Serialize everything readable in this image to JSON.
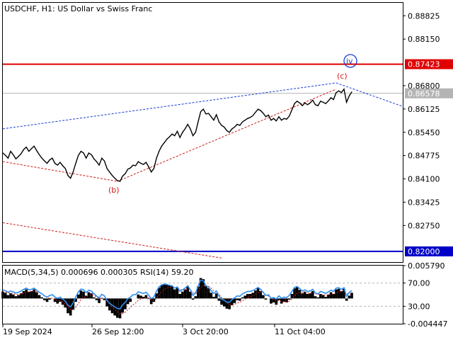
{
  "title": "USDCHF, H1:  US Dollar vs Swiss Franc",
  "colors": {
    "price": "#000000",
    "resistance": "#e00000",
    "support": "#0000c8",
    "current_line": "#b4b4b4",
    "channel_upper": "#1a3cd8",
    "channel_lower": "#d01818",
    "wave_red": "#d01818",
    "wave_blue": "#1a3cd8",
    "macd_hist": "#000000",
    "rsi": "#2d8ef0",
    "macd_signal": "#d01818"
  },
  "chart_data": [
    {
      "type": "line",
      "title": "USDCHF, H1:  US Dollar vs Swiss Franc",
      "x_ticks": [
        "19 Sep 2024",
        "26 Sep 12:00",
        "3 Oct 20:00",
        "11 Oct 04:00"
      ],
      "y_ticks": [
        "0.88825",
        "0.88150",
        "0.86800",
        "0.86125",
        "0.85450",
        "0.84775",
        "0.84100",
        "0.83425",
        "0.82750"
      ],
      "ylim": [
        0.8169,
        0.892
      ],
      "levels": [
        {
          "label": "0.87423",
          "value": 0.87423,
          "role": "resistance"
        },
        {
          "label": "0.86578",
          "value": 0.86578,
          "role": "current"
        },
        {
          "label": "0.82000",
          "value": 0.82,
          "role": "support"
        }
      ],
      "series": [
        {
          "values": [
            0.8485,
            0.8478,
            0.847,
            0.849,
            0.848,
            0.8468,
            0.8475,
            0.8483,
            0.8495,
            0.8502,
            0.849,
            0.8498,
            0.8505,
            0.8492,
            0.848,
            0.847,
            0.8462,
            0.8455,
            0.8465,
            0.847,
            0.8455,
            0.845,
            0.8458,
            0.8448,
            0.844,
            0.842,
            0.8412,
            0.843,
            0.8455,
            0.8478,
            0.849,
            0.8485,
            0.847,
            0.8485,
            0.848,
            0.8468,
            0.846,
            0.845,
            0.847,
            0.8462,
            0.844,
            0.843,
            0.842,
            0.8412,
            0.8405,
            0.8403,
            0.8418,
            0.8425,
            0.8438,
            0.8442,
            0.845,
            0.8448,
            0.846,
            0.8455,
            0.8452,
            0.8458,
            0.8445,
            0.843,
            0.844,
            0.847,
            0.849,
            0.8505,
            0.8515,
            0.8525,
            0.8532,
            0.854,
            0.8535,
            0.8548,
            0.853,
            0.8545,
            0.8555,
            0.8568,
            0.8555,
            0.8535,
            0.8545,
            0.8575,
            0.8605,
            0.8612,
            0.8598,
            0.86,
            0.859,
            0.858,
            0.8596,
            0.8575,
            0.8565,
            0.856,
            0.855,
            0.8545,
            0.8555,
            0.856,
            0.8568,
            0.8565,
            0.8575,
            0.858,
            0.8585,
            0.8588,
            0.8593,
            0.8603,
            0.8612,
            0.8608,
            0.86,
            0.859,
            0.8595,
            0.858,
            0.8585,
            0.8578,
            0.859,
            0.858,
            0.8585,
            0.8583,
            0.8592,
            0.861,
            0.8628,
            0.8635,
            0.863,
            0.8622,
            0.863,
            0.8625,
            0.863,
            0.8638,
            0.8625,
            0.8622,
            0.8635,
            0.8632,
            0.8628,
            0.8636,
            0.8645,
            0.864,
            0.866,
            0.8665,
            0.866,
            0.867,
            0.8632,
            0.865,
            0.8662
          ],
          "label_points": [
            {
              "x": 0,
              "y": 0.8485,
              "label": ""
            },
            {
              "x": 44,
              "y": 0.8403,
              "label": "(b)"
            },
            {
              "x": 128,
              "y": 0.867,
              "label": "(c)"
            }
          ]
        }
      ],
      "annotations": [
        {
          "text": "(b)",
          "color": "wave_red"
        },
        {
          "text": "(c)",
          "color": "wave_red"
        },
        {
          "text": "iv",
          "color": "wave_blue"
        }
      ]
    },
    {
      "type": "bar",
      "title": "MACD(5,34,5) 0.000696 0.000305 RSI(14) 59.20",
      "y_ticks": [
        "0.005790",
        "70.00",
        "30.00",
        "-0.004447"
      ],
      "ylim": [
        -0.004447,
        0.00579
      ],
      "values": [
        0.0012,
        0.001,
        0.0006,
        0.0009,
        0.0007,
        0.0004,
        0.0006,
        0.0009,
        0.0013,
        0.0016,
        0.0012,
        0.0013,
        0.0016,
        0.0011,
        0.0006,
        0.0002,
        -0.0003,
        -0.0006,
        -0.0002,
        0.0,
        -0.0006,
        -0.0009,
        -0.0006,
        -0.0011,
        -0.0016,
        -0.0026,
        -0.003,
        -0.002,
        -0.0006,
        0.0007,
        0.0014,
        0.0012,
        0.0005,
        0.0011,
        0.0009,
        0.0002,
        -0.0003,
        -0.0008,
        0.0001,
        -0.0003,
        -0.0014,
        -0.0021,
        -0.0026,
        -0.003,
        -0.0034,
        -0.0035,
        -0.0025,
        -0.0019,
        -0.001,
        -0.0006,
        0.0,
        0.0,
        0.0007,
        0.0005,
        0.0003,
        0.0006,
        -0.0001,
        -0.001,
        -0.0006,
        0.0009,
        0.0019,
        0.0024,
        0.0026,
        0.0025,
        0.0023,
        0.0022,
        0.0016,
        0.0019,
        0.0008,
        0.0012,
        0.0016,
        0.0022,
        0.0012,
        -0.0002,
        0.0004,
        0.0021,
        0.0036,
        0.0034,
        0.0022,
        0.0018,
        0.001,
        0.0003,
        0.0009,
        -0.0004,
        -0.0011,
        -0.0014,
        -0.0018,
        -0.0019,
        -0.0012,
        -0.0008,
        -0.0003,
        -0.0004,
        0.0002,
        0.0005,
        0.0008,
        0.0008,
        0.001,
        0.0014,
        0.0018,
        0.0013,
        0.0006,
        -0.0002,
        0.0,
        -0.0009,
        -0.0007,
        -0.0011,
        -0.0003,
        -0.0009,
        -0.0006,
        -0.0007,
        -0.0002,
        0.0008,
        0.0018,
        0.002,
        0.0015,
        0.0009,
        0.0012,
        0.0008,
        0.0009,
        0.0013,
        0.0004,
        0.0002,
        0.0008,
        0.0006,
        0.0003,
        0.0007,
        0.0011,
        0.0008,
        0.0016,
        0.0017,
        0.0013,
        0.0017,
        -0.0004,
        0.0005,
        0.001
      ],
      "series": [
        {
          "name": "RSI(14)",
          "ylim": [
            0,
            100
          ]
        }
      ]
    }
  ]
}
